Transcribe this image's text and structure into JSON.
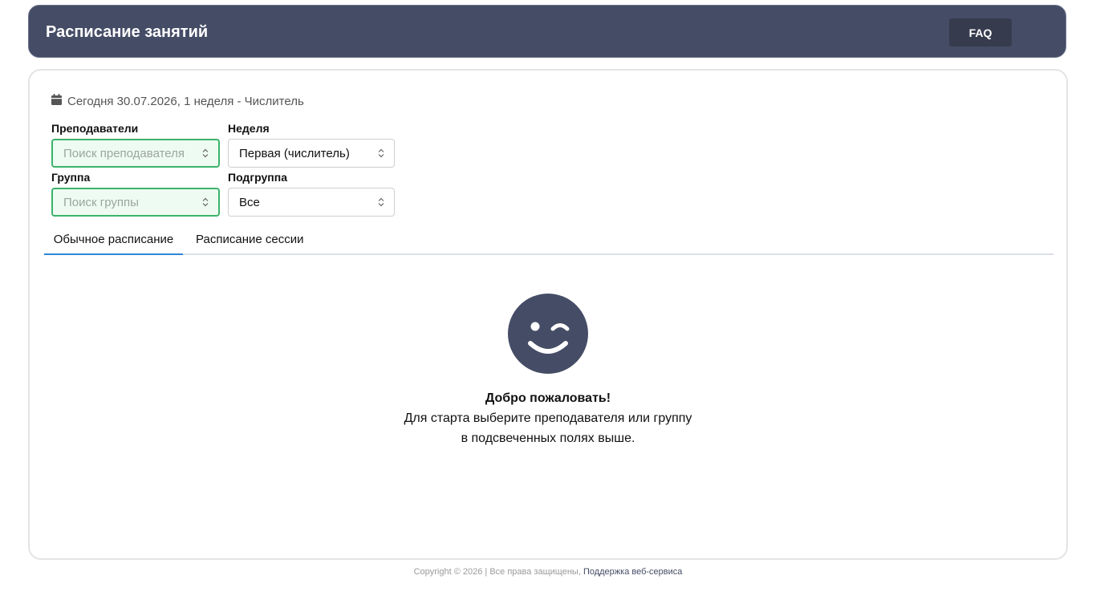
{
  "header": {
    "title": "Расписание занятий",
    "faq_label": "FAQ"
  },
  "today": {
    "text": "Сегодня 30.07.2026, 1 неделя - Числитель",
    "icon": "calendar-icon"
  },
  "filters": {
    "teachers": {
      "label": "Преподаватели",
      "placeholder": "Поиск преподавателя"
    },
    "week": {
      "label": "Неделя",
      "value": "Первая (числитель)"
    },
    "group": {
      "label": "Группа",
      "placeholder": "Поиск группы"
    },
    "subgroup": {
      "label": "Подгруппа",
      "value": "Все"
    }
  },
  "tabs": [
    {
      "label": "Обычное расписание",
      "active": true
    },
    {
      "label": "Расписание сессии",
      "active": false
    }
  ],
  "welcome": {
    "icon": "wink-smiley-icon",
    "title": "Добро пожаловать!",
    "line1": "Для старта выберите преподавателя или группу",
    "line2": "в подсвеченных полях выше."
  },
  "footer": {
    "copyright": "Copyright © 2026 | Все права защищены,",
    "link": "Поддержка веб-сервиса"
  },
  "colors": {
    "header_bg": "#454d66",
    "faq_bg": "#363c4e",
    "highlight_border": "#3bb36a",
    "highlight_bg": "#eefbf2",
    "tab_active": "#2f86d6"
  }
}
